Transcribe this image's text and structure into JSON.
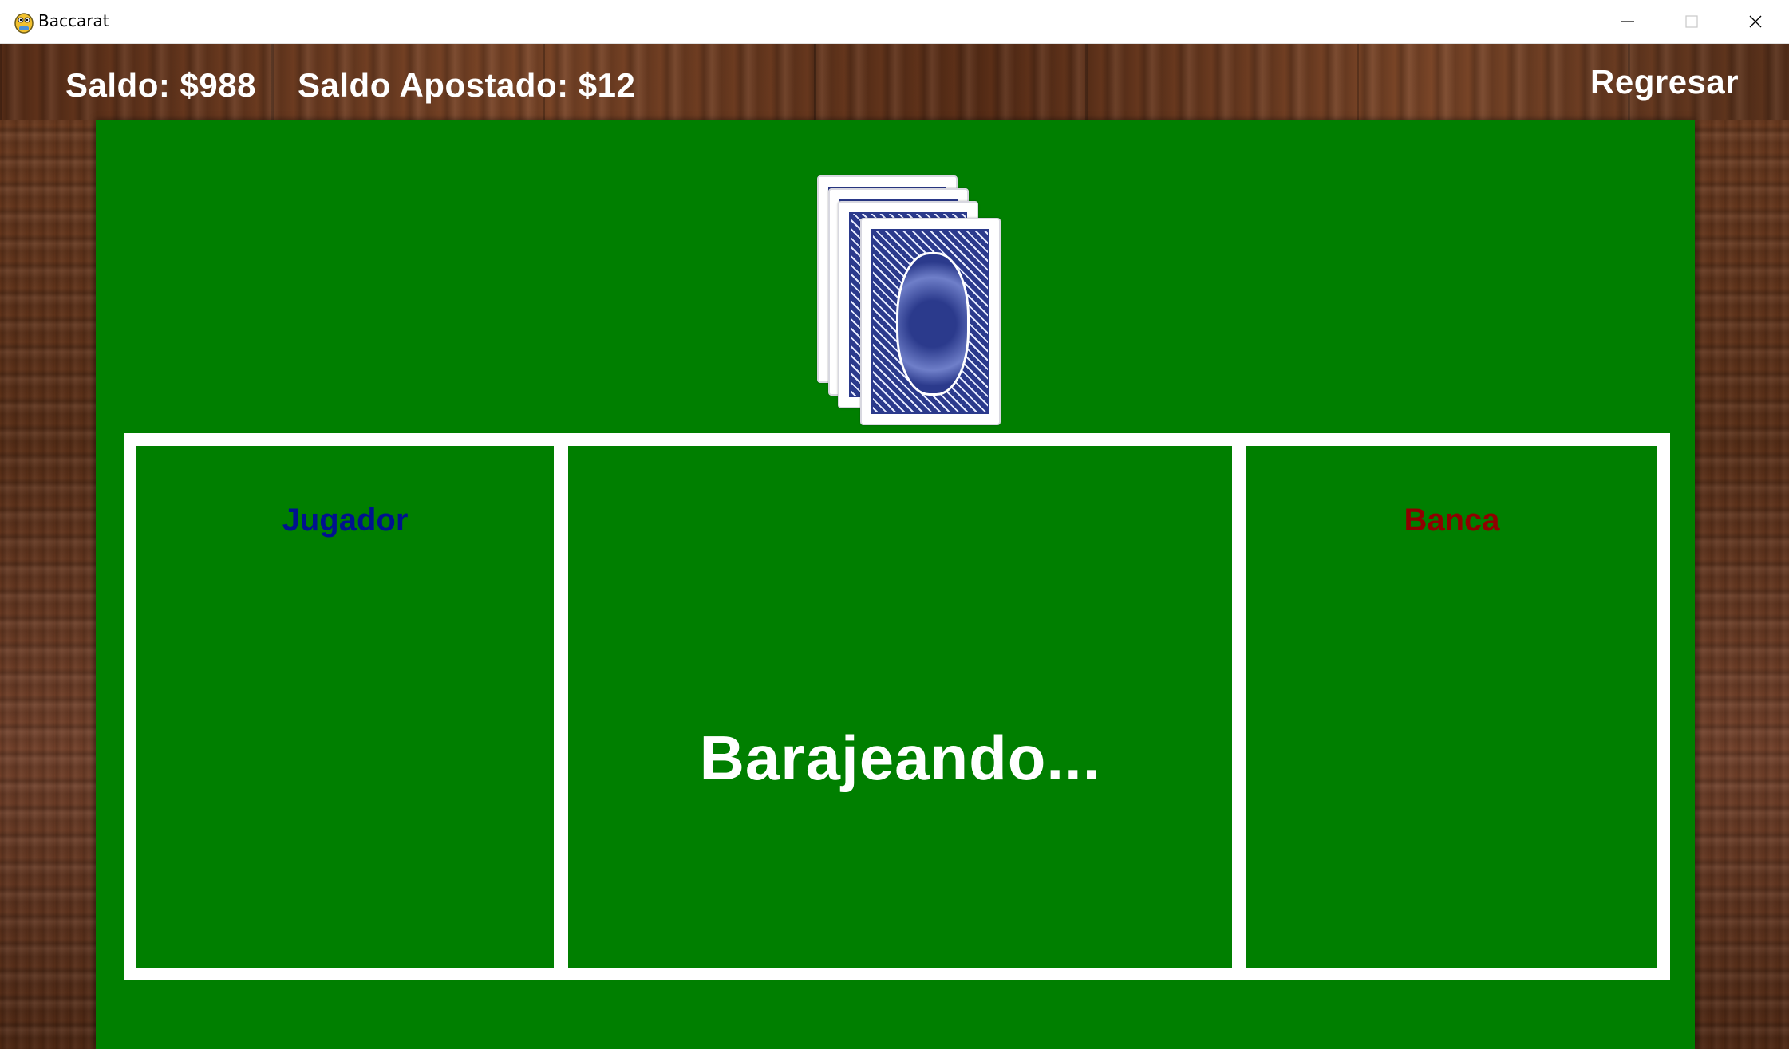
{
  "window": {
    "title": "Baccarat",
    "icon": "pygame-snake-icon",
    "controls": [
      "minimize-icon",
      "maximize-icon",
      "close-icon"
    ]
  },
  "hud": {
    "balance": "Saldo: $988",
    "bet_amount": "Saldo Apostado: $12",
    "back_button": "Regresar"
  },
  "deck": {
    "visible_cards": 4,
    "face": "down"
  },
  "board": {
    "player_label": "Jugador",
    "banker_label": "Banca",
    "status": "Barajeando..."
  },
  "colors": {
    "felt": "#007f00",
    "player_label": "#00128f",
    "banker_label": "#8f0000",
    "border": "#ffffff",
    "card_back": "#2b3a8c"
  }
}
